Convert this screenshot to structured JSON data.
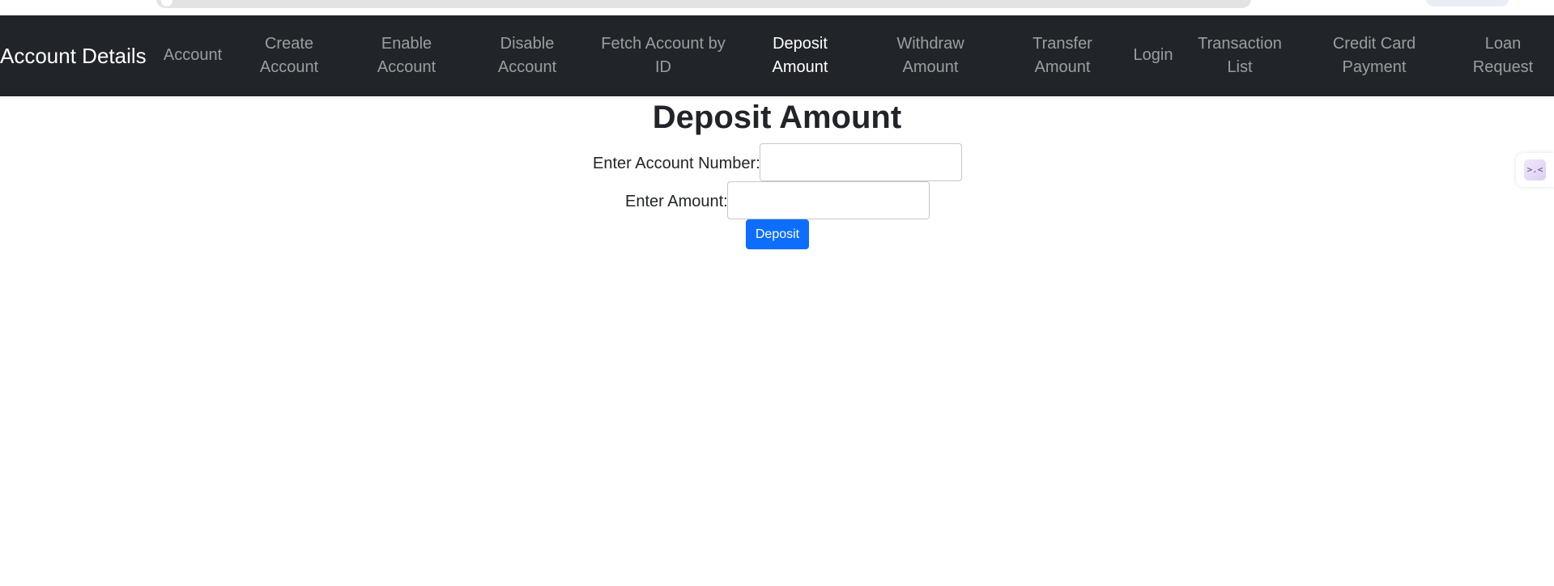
{
  "navbar": {
    "brand": "Account Details",
    "items": [
      {
        "label": "Account"
      },
      {
        "label": "Create Account"
      },
      {
        "label": "Enable Account"
      },
      {
        "label": "Disable Account"
      },
      {
        "label": "Fetch Account by ID"
      },
      {
        "label": "Deposit Amount",
        "active": true
      },
      {
        "label": "Withdraw Amount"
      },
      {
        "label": "Transfer Amount"
      },
      {
        "label": "Login"
      },
      {
        "label": "Transaction List"
      },
      {
        "label": "Credit Card Payment"
      },
      {
        "label": "Loan Request"
      }
    ]
  },
  "page": {
    "title": "Deposit Amount"
  },
  "form": {
    "account_label": "Enter Account Number:",
    "account_value": "",
    "amount_label": "Enter Amount:",
    "amount_value": "",
    "submit_label": "Deposit"
  },
  "widget": {
    "icon": "code-face-icon",
    "glyph": ">.<"
  },
  "colors": {
    "navbar_bg": "#212529",
    "primary": "#0d6efd",
    "text": "#212529"
  }
}
